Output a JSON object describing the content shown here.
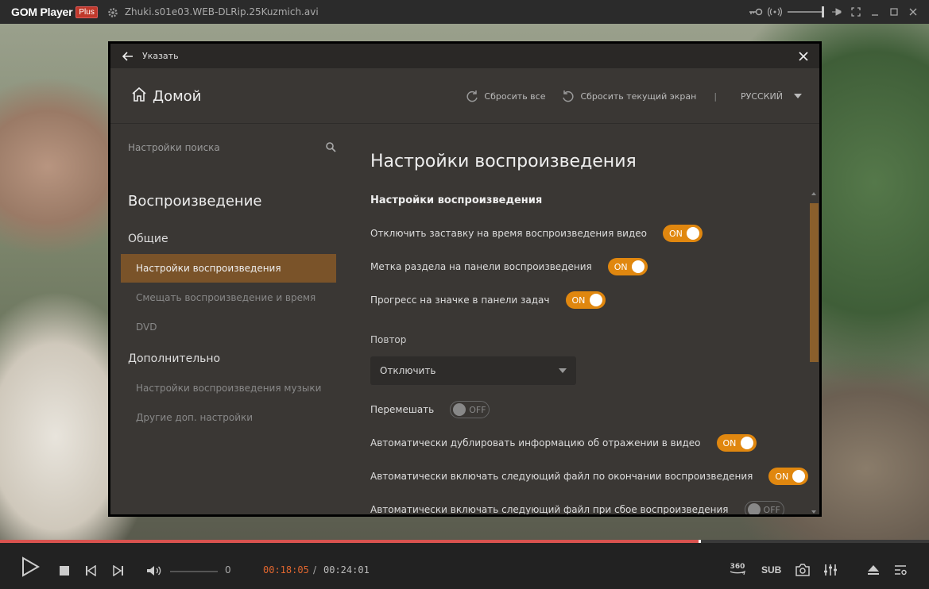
{
  "app": {
    "logo_text": "GOM Player",
    "logo_badge": "Plus",
    "filename": "Zhuki.s01e03.WEB-DLRip.25Kuzmich.avi"
  },
  "dialog": {
    "header_title": "Указать",
    "home_label": "Домой",
    "reset_all": "Сбросить все",
    "reset_current": "Сбросить текущий экран",
    "separator": "|",
    "language": "РУССКИЙ"
  },
  "sidebar": {
    "search_placeholder": "Настройки поиска",
    "section": "Воспроизведение",
    "group_general": "Общие",
    "items_general": [
      "Настройки воспроизведения",
      "Смещать воспроизведение и время",
      "DVD"
    ],
    "group_advanced": "Дополнительно",
    "items_advanced": [
      "Настройки воспроизведения музыки",
      "Другие доп. настройки"
    ]
  },
  "main": {
    "title": "Настройки воспроизведения",
    "section_title": "Настройки воспроизведения",
    "settings": [
      {
        "label": "Отключить заставку на время воспроизведения видео",
        "state": "ON"
      },
      {
        "label": "Метка раздела на панели воспроизведения",
        "state": "ON"
      },
      {
        "label": "Прогресс на значке в панели задач",
        "state": "ON"
      }
    ],
    "repeat_label": "Повтор",
    "repeat_value": "Отключить",
    "settings2": [
      {
        "label": "Перемешать",
        "state": "OFF"
      },
      {
        "label": "Автоматически дублировать информацию об отражении в видео",
        "state": "ON"
      },
      {
        "label": "Автоматически включать следующий файл по окончании воспроизведения",
        "state": "ON"
      },
      {
        "label": "Автоматически включать следующий файл при сбое воспроизведения",
        "state": "OFF"
      }
    ]
  },
  "player": {
    "volume": "0",
    "time_current": "00:18:05",
    "time_separator": "/",
    "time_total": "00:24:01",
    "progress_fraction": 0.753,
    "btn_360": "360",
    "btn_sub": "SUB"
  },
  "colors": {
    "accent_orange": "#e0870f",
    "active_item": "#7a5329",
    "seek_red": "#d9534f",
    "time_orange": "#e0662f"
  }
}
